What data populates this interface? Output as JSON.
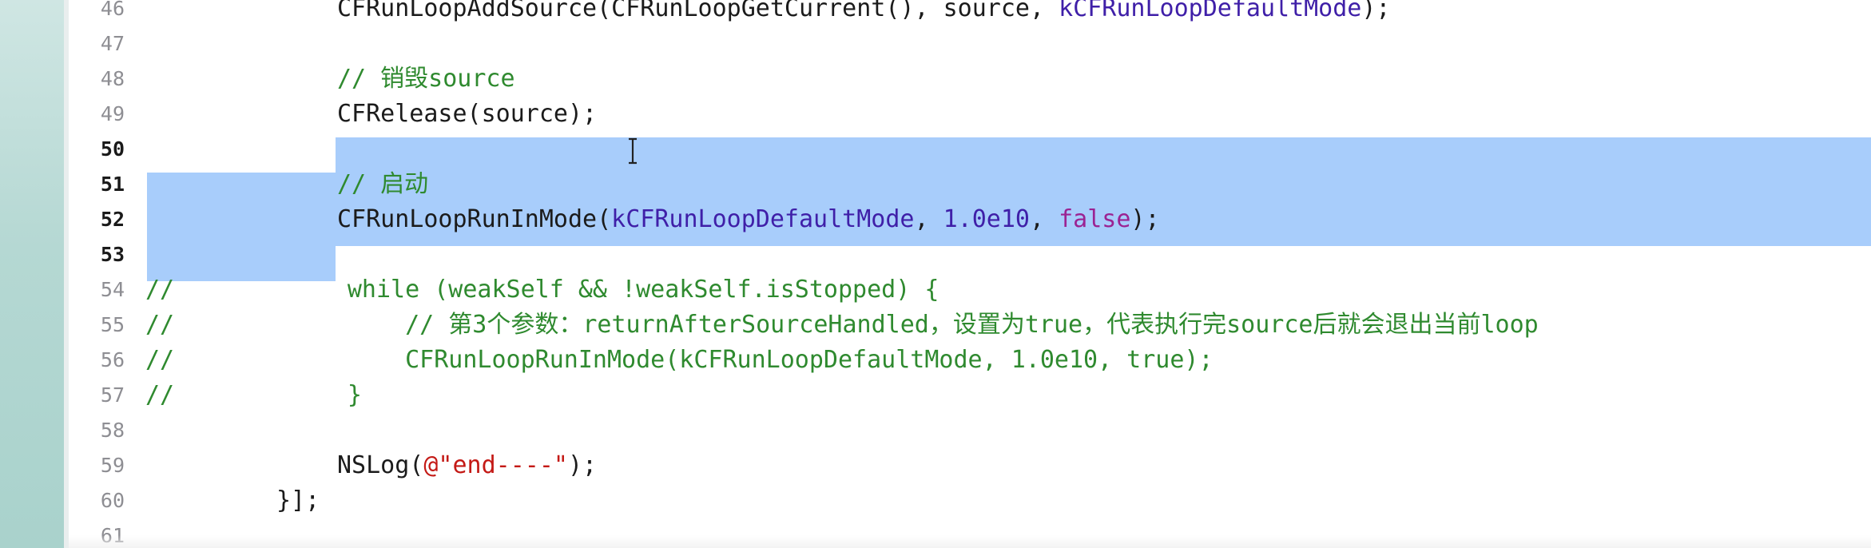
{
  "editor": {
    "lines": [
      {
        "num": "46",
        "segments": [
          {
            "t": "CFRunLoopAddSource(CFRunLoopGetCurrent(), source, ",
            "c": "fn"
          },
          {
            "t": "kCFRunLoopDefaultMode",
            "c": "cn"
          },
          {
            "t": ");",
            "c": "fn"
          }
        ]
      },
      {
        "num": "47",
        "segments": []
      },
      {
        "num": "48",
        "segments": [
          {
            "t": "// 销毁source",
            "c": "cm"
          }
        ]
      },
      {
        "num": "49",
        "segments": [
          {
            "t": "CFRelease(source);",
            "c": "fn"
          }
        ]
      },
      {
        "num": "50",
        "segments": []
      },
      {
        "num": "51",
        "segments": [
          {
            "t": "// 启动",
            "c": "cm"
          }
        ]
      },
      {
        "num": "52",
        "segments": [
          {
            "t": "CFRunLoopRunInMode(",
            "c": "fn"
          },
          {
            "t": "kCFRunLoopDefaultMode",
            "c": "cn"
          },
          {
            "t": ", ",
            "c": "fn"
          },
          {
            "t": "1.0e10",
            "c": "cn"
          },
          {
            "t": ", ",
            "c": "fn"
          },
          {
            "t": "false",
            "c": "kw"
          },
          {
            "t": ");",
            "c": "fn"
          }
        ]
      },
      {
        "num": "53",
        "segments": []
      },
      {
        "num": "54",
        "segments": [
          {
            "t": "//            while (weakSelf && !weakSelf.isStopped) {",
            "c": "cm"
          }
        ]
      },
      {
        "num": "55",
        "segments": [
          {
            "t": "//                // 第3个参数：returnAfterSourceHandled，设置为true，代表执行完source后就会退出当前loop",
            "c": "cm"
          }
        ]
      },
      {
        "num": "56",
        "segments": [
          {
            "t": "//                CFRunLoopRunInMode(kCFRunLoopDefaultMode, 1.0e10, true);",
            "c": "cm"
          }
        ]
      },
      {
        "num": "57",
        "segments": [
          {
            "t": "//            }",
            "c": "cm"
          }
        ]
      },
      {
        "num": "58",
        "segments": []
      },
      {
        "num": "59",
        "segments": [
          {
            "t": "NSLog(",
            "c": "fn"
          },
          {
            "t": "@\"end----\"",
            "c": "str"
          },
          {
            "t": ");",
            "c": "fn"
          }
        ]
      },
      {
        "num": "60",
        "segments": [
          {
            "t": "}];",
            "c": "fn"
          }
        ]
      },
      {
        "num": "61",
        "segments": []
      }
    ],
    "selected_lines": [
      "50",
      "51",
      "52",
      "53"
    ],
    "cursor_icon": "ibeam-cursor-icon"
  }
}
